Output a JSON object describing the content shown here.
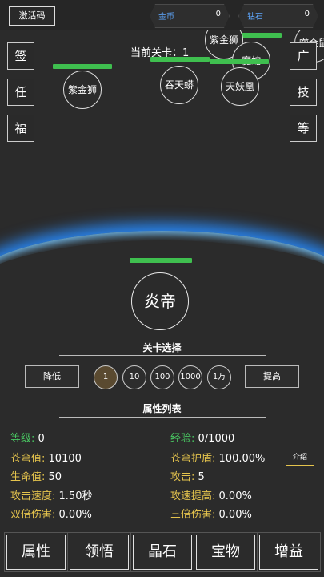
{
  "topbar": {
    "code_label": "激活码",
    "gold": {
      "label": "金币",
      "value": "0"
    },
    "diamond": {
      "label": "钻石",
      "value": "0"
    }
  },
  "left_buttons": [
    "签",
    "任",
    "福"
  ],
  "right_buttons": [
    "广",
    "技",
    "等"
  ],
  "stage": "当前关卡：1",
  "enemies": [
    "紫金狮",
    "吞天蟒",
    "天妖凰",
    "紫金狮",
    "魔蛇",
    "噬金鼠"
  ],
  "hero_name": "炎帝",
  "level_select": {
    "title": "关卡选择",
    "lower": "降低",
    "raise": "提高",
    "steps": [
      "1",
      "10",
      "100",
      "1000",
      "1万"
    ]
  },
  "attributes": {
    "title": "属性列表",
    "intro_label": "介绍",
    "rows": [
      {
        "k": "等级:",
        "v": "0"
      },
      {
        "k": "经验:",
        "v": "0/1000"
      },
      {
        "k": "苍穹值:",
        "v": "10100"
      },
      {
        "k": "苍穹护盾:",
        "v": "100.00%"
      },
      {
        "k": "生命值:",
        "v": "50"
      },
      {
        "k": "攻击:",
        "v": "5"
      },
      {
        "k": "攻击速度:",
        "v": "1.50秒"
      },
      {
        "k": "攻速提高:",
        "v": "0.00%"
      },
      {
        "k": "双倍伤害:",
        "v": "0.00%"
      },
      {
        "k": "三倍伤害:",
        "v": "0.00%"
      }
    ]
  },
  "tabs": [
    "属性",
    "领悟",
    "晶石",
    "宝物",
    "增益"
  ],
  "colors": {
    "accent_gold": "#e5c44d",
    "accent_green": "#49c862",
    "hp_green": "#3fbf4f",
    "glow_blue": "#2a8cff"
  }
}
